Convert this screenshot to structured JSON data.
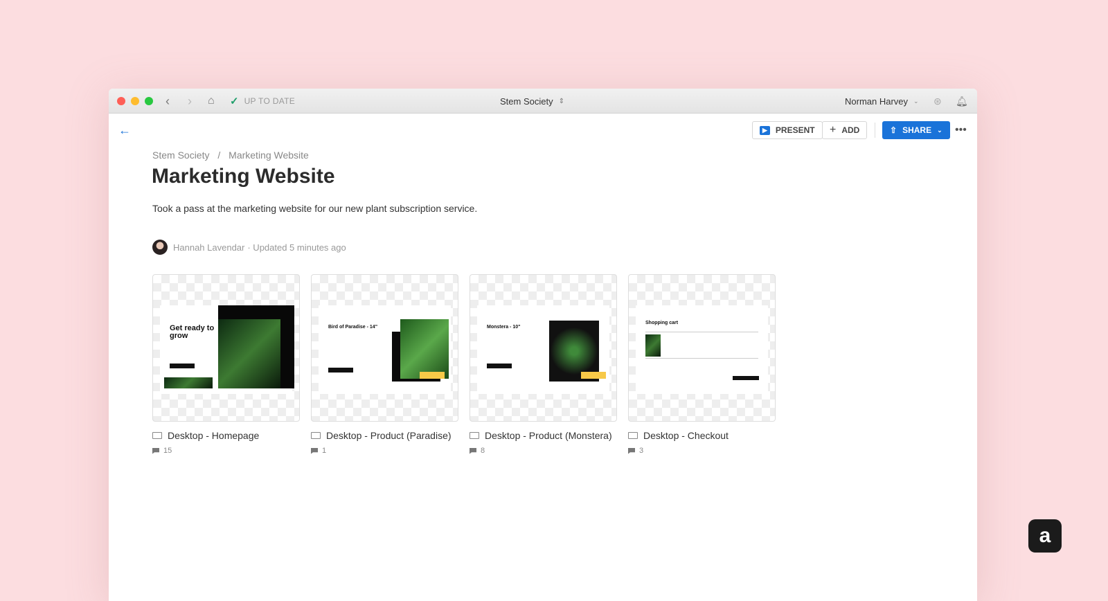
{
  "titlebar": {
    "status": "UP TO DATE",
    "project": "Stem Society",
    "user": "Norman Harvey"
  },
  "toolbar": {
    "present": "PRESENT",
    "add": "ADD",
    "share": "SHARE"
  },
  "breadcrumb": {
    "root": "Stem Society",
    "sep": "/",
    "current": "Marketing Website"
  },
  "title": "Marketing Website",
  "description": "Took a pass at the marketing website for our new plant subscription service.",
  "meta": {
    "author": "Hannah Lavendar",
    "updated": "· Updated 5 minutes ago"
  },
  "artboards": [
    {
      "name": "Desktop - Homepage",
      "comments": "15",
      "headline": "Get ready to grow"
    },
    {
      "name": "Desktop - Product (Paradise)",
      "comments": "1",
      "headline": "Bird of Paradise - 14\""
    },
    {
      "name": "Desktop - Product (Monstera)",
      "comments": "8",
      "headline": "Monstera - 10\""
    },
    {
      "name": "Desktop - Checkout",
      "comments": "3",
      "headline": "Shopping cart"
    }
  ],
  "colors": {
    "accent": "#1a73d9",
    "background": "#fcdde0"
  }
}
